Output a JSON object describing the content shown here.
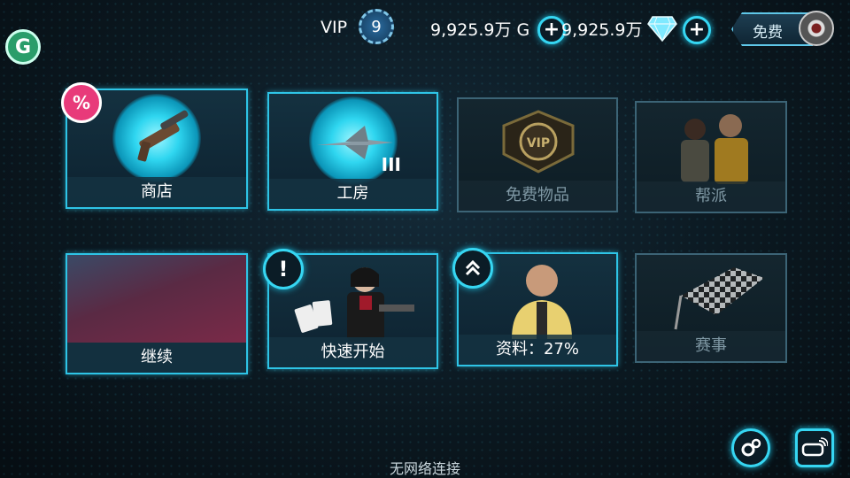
{
  "header": {
    "vip_label": "VIP",
    "vip_level": "9",
    "cash": "9,925.9万 G",
    "gold": "9,925.9万",
    "free_label": "免费"
  },
  "tiles": {
    "shop": "商店",
    "workshop": "工房",
    "workshop_tier": "III",
    "free_items": "免费物品",
    "gang": "帮派",
    "continue": "继续",
    "quickstart": "快速开始",
    "profile": "资料：27%",
    "events": "赛事"
  },
  "shop_badge": "%",
  "quickstart_badge": "!",
  "status": "无网络连接",
  "colors": {
    "accent": "#2ec4e6",
    "sale_badge": "#e83a7a",
    "logo_green": "#2a9d6a"
  }
}
